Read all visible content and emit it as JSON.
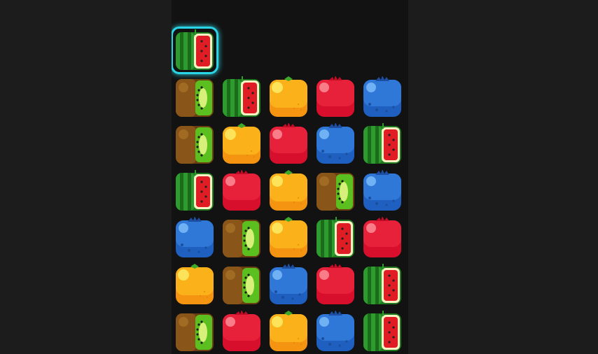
{
  "board": {
    "selected": {
      "row": 0,
      "col": 0
    },
    "rows": [
      [
        "watermelon",
        null,
        null,
        null,
        null
      ],
      [
        "kiwi",
        "watermelon",
        "orange",
        "strawberry",
        "blueberry"
      ],
      [
        "kiwi",
        "orange",
        "strawberry",
        "blueberry",
        "watermelon"
      ],
      [
        "watermelon",
        "strawberry",
        "orange",
        "kiwi",
        "blueberry"
      ],
      [
        "blueberry",
        "kiwi",
        "orange",
        "watermelon",
        "strawberry"
      ],
      [
        "orange",
        "kiwi",
        "blueberry",
        "strawberry",
        "watermelon"
      ],
      [
        "kiwi",
        "strawberry",
        "orange",
        "blueberry",
        "watermelon"
      ]
    ]
  },
  "fruit_icons": {
    "watermelon": "watermelon-icon",
    "kiwi": "kiwi-icon",
    "orange": "orange-icon",
    "strawberry": "strawberry-icon",
    "blueberry": "blueberry-icon"
  },
  "colors": {
    "background": "#1c1c1c",
    "board": "#121212",
    "selection": "#2ad6e6"
  }
}
